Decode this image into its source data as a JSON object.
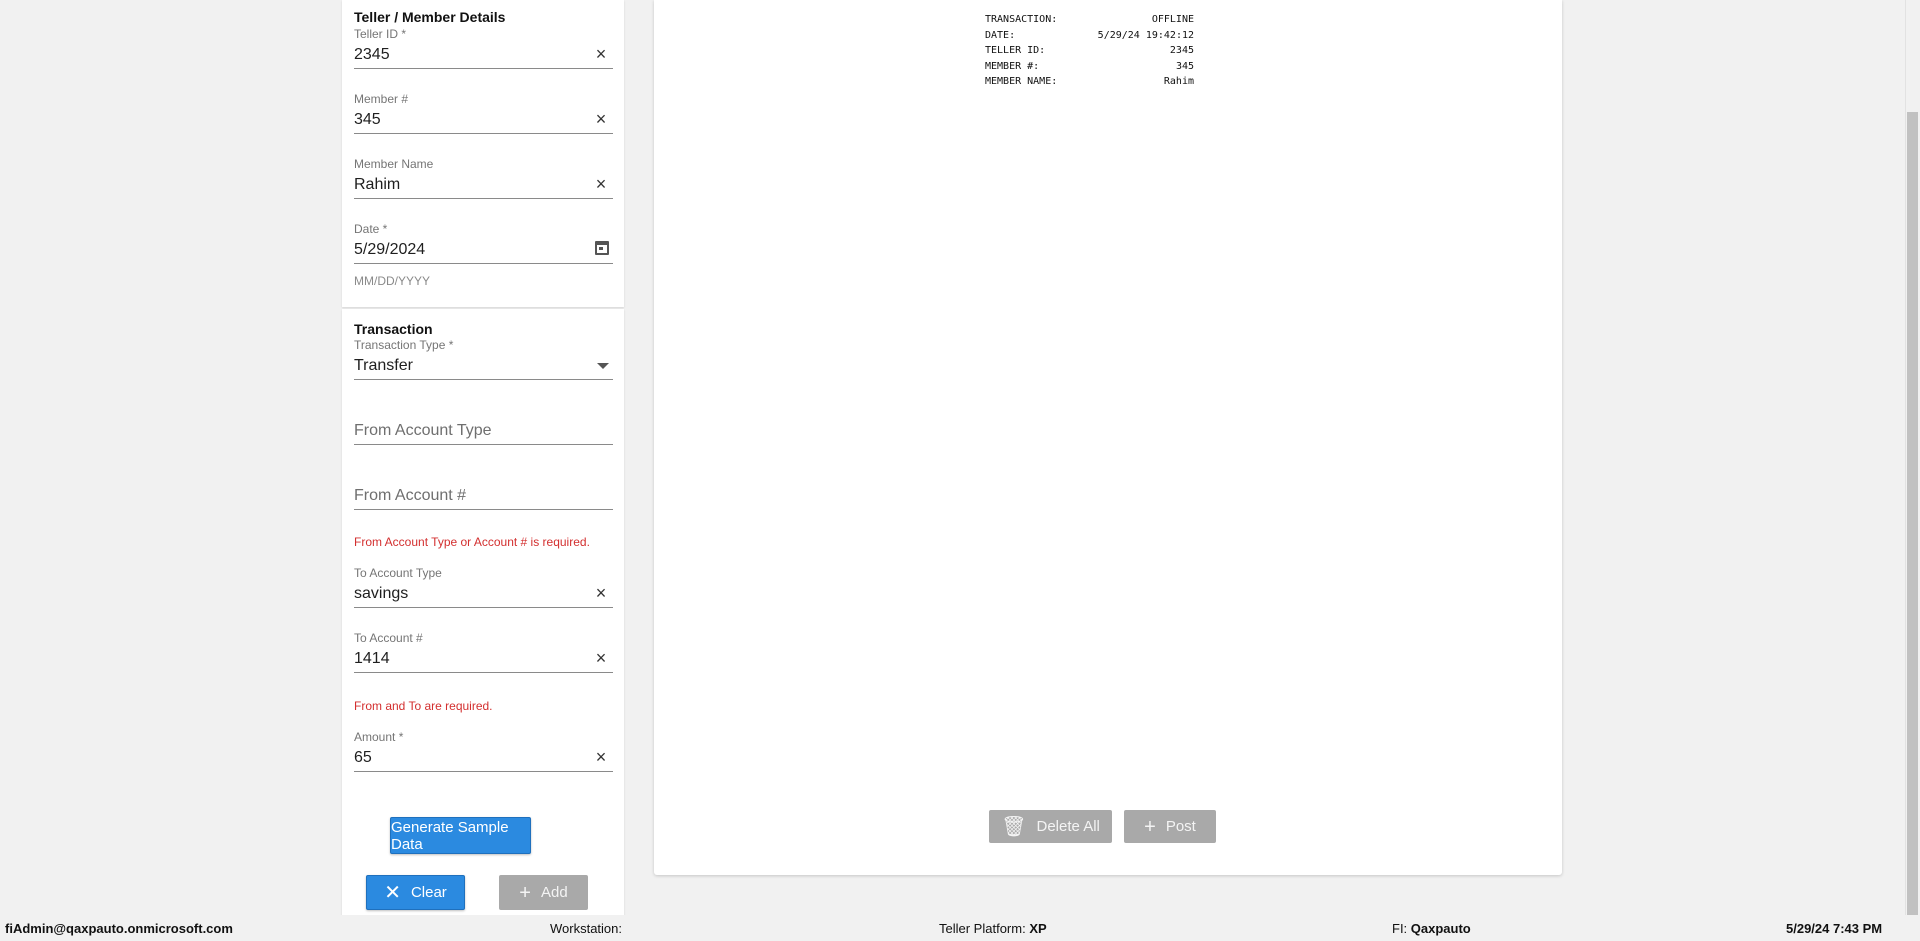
{
  "teller_section": {
    "title": "Teller / Member Details",
    "teller_id": {
      "label": "Teller ID *",
      "value": "2345"
    },
    "member_number": {
      "label": "Member #",
      "value": "345"
    },
    "member_name": {
      "label": "Member Name",
      "value": "Rahim"
    },
    "date": {
      "label": "Date *",
      "value": "5/29/2024",
      "hint": "MM/DD/YYYY"
    }
  },
  "transaction_section": {
    "title": "Transaction",
    "transaction_type": {
      "label": "Transaction Type *",
      "value": "Transfer"
    },
    "from_account_type": {
      "placeholder": "From Account Type"
    },
    "from_account_number": {
      "placeholder": "From Account #"
    },
    "from_error": "From Account Type or Account # is required.",
    "to_account_type": {
      "label": "To Account Type",
      "value": "savings"
    },
    "to_account_number": {
      "label": "To Account #",
      "value": "1414"
    },
    "to_error": "From and To are required.",
    "amount": {
      "label": "Amount *",
      "value": "65"
    },
    "generate_label": "Generate Sample Data",
    "clear_label": "Clear",
    "add_label": "Add"
  },
  "receipt": {
    "lines": [
      {
        "key": "TRANSACTION:",
        "value": "OFFLINE"
      },
      {
        "key": "DATE:",
        "value": "5/29/24 19:42:12"
      },
      {
        "key": "TELLER ID:",
        "value": "2345"
      },
      {
        "key": "MEMBER #:",
        "value": "345"
      },
      {
        "key": "MEMBER NAME:",
        "value": "Rahim"
      }
    ],
    "delete_all_label": "Delete All",
    "post_label": "Post"
  },
  "status_bar": {
    "user": "fiAdmin@qaxpauto.onmicrosoft.com",
    "workstation_label": "Workstation:",
    "workstation_value": "",
    "platform_label": "Teller Platform:",
    "platform_value": "XP",
    "fi_label": "FI:",
    "fi_value": "Qaxpauto",
    "datetime": "5/29/24 7:43 PM"
  },
  "colors": {
    "primary": "#2b8ae0",
    "error": "#d32f2f",
    "disabled": "#a9a9a9"
  }
}
